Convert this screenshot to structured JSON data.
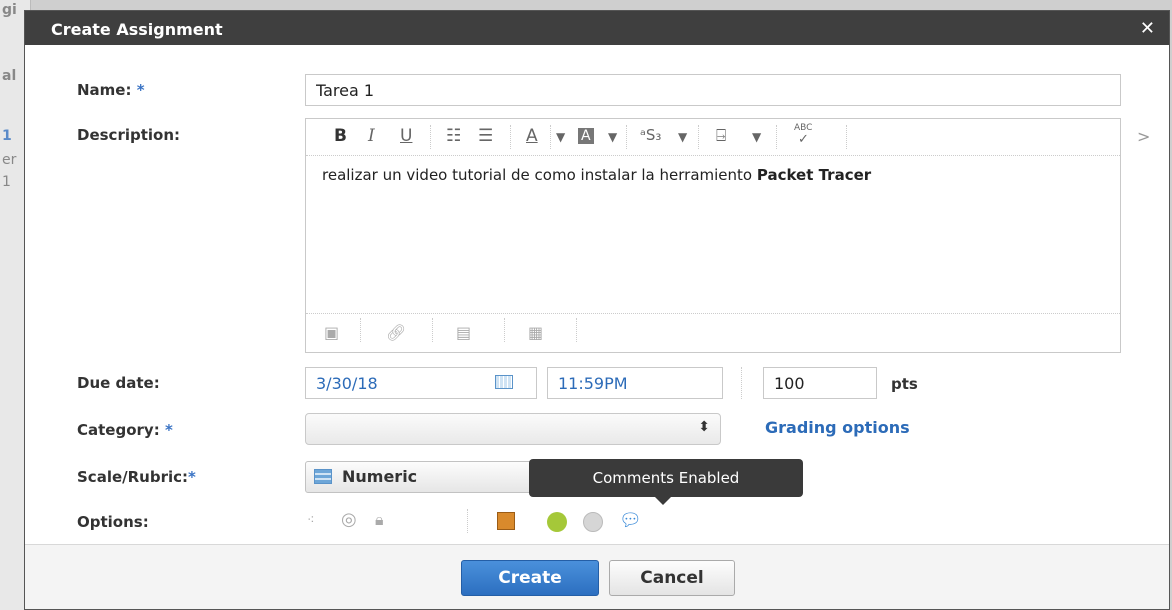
{
  "background": {
    "fragments": [
      "gi",
      "al",
      "1",
      "er",
      "1"
    ]
  },
  "dialog": {
    "title": "Create Assignment",
    "close_glyph": "✕",
    "name": {
      "label": "Name:",
      "required": "*",
      "value": "Tarea 1"
    },
    "description": {
      "label": "Description:",
      "toolbar": {
        "bold": "B",
        "italic": "I",
        "underline": "U",
        "bullet_list": "☷",
        "number_list": "☰",
        "font_color": "A",
        "highlight": "A",
        "superscript": "ᵃS₃",
        "insert": "⍈",
        "spellcheck": "ABC",
        "more": ">"
      },
      "text_plain": "realizar un video tutorial de como instalar la herramiento ",
      "text_bold": "Packet Tracer"
    },
    "due_date": {
      "label": "Due date:",
      "date": "3/30/18",
      "time": "11:59PM",
      "points": "100",
      "points_unit": "pts"
    },
    "category": {
      "label": "Category:",
      "required": "*",
      "value": "",
      "link": "Grading options"
    },
    "scale": {
      "label": "Scale/Rubric:",
      "required": "*",
      "value": "Numeric"
    },
    "options": {
      "label": "Options:",
      "tooltip": "Comments Enabled"
    },
    "buttons": {
      "create": "Create",
      "cancel": "Cancel"
    },
    "colors": {
      "titlebar": "#3f3f3f",
      "accent": "#2c6bb8",
      "green_dot": "#a5c839"
    }
  }
}
